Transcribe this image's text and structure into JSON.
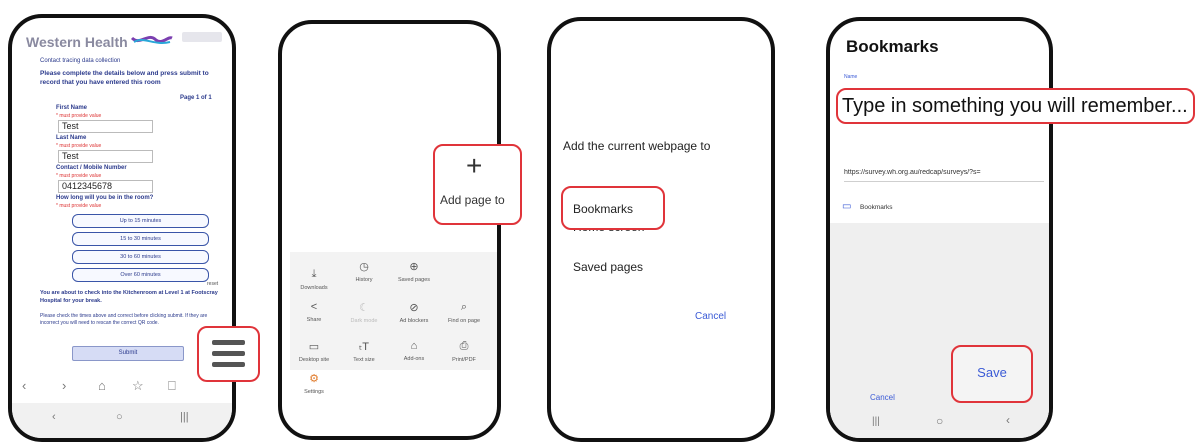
{
  "phone1": {
    "brand": "Western Health",
    "header_small": "Contact tracing data collection",
    "intro": "Please complete the details below and press submit to record that you have entered this room",
    "page_indicator": "Page 1 of 1",
    "first_name_label": "First Name",
    "first_name_value": "Test",
    "last_name_label": "Last Name",
    "last_name_value": "Test",
    "contact_label": "Contact / Mobile Number",
    "contact_value": "0412345678",
    "duration_question": "How long will you be in the room?",
    "required_note": "* must provide value",
    "duration_options": [
      "Up to 15 minutes",
      "15 to 30 minutes",
      "30 to 60 minutes",
      "Over 60 minutes"
    ],
    "reset_label": "reset",
    "checkout_text": "You are about to check into the Kitchenroom at Level 1 at Footscray Hospital for your break.",
    "footer_text": "Please check the times above and correct before clicking submit. If they are incorrect you will need to rescan the correct QR code.",
    "submit_label": "Submit",
    "nav_icons": [
      "‹",
      "›",
      "⌂",
      "☆",
      "⎕"
    ]
  },
  "phone2": {
    "menu_items": [
      {
        "icon": "⤓",
        "label": "Downloads"
      },
      {
        "icon": "◷",
        "label": "History"
      },
      {
        "icon": "⊕",
        "label": "Saved pages"
      },
      {
        "icon": "<",
        "label": "Share"
      },
      {
        "icon": "☾",
        "label": "Dark mode"
      },
      {
        "icon": "⊘",
        "label": "Ad blockers"
      },
      {
        "icon": "⌕",
        "label": "Find on page"
      },
      {
        "icon": "▭",
        "label": "Desktop site"
      },
      {
        "icon": "ₜT",
        "label": "Text size"
      },
      {
        "icon": "⌂",
        "label": "Add-ons"
      },
      {
        "icon": "⎙",
        "label": "Print/PDF"
      },
      {
        "icon": "⚙",
        "label": "Settings"
      }
    ],
    "add_page_label": "Add page to"
  },
  "phone3": {
    "title": "Add the current webpage to",
    "options": [
      "Bookmarks",
      "Home screen",
      "Saved pages"
    ],
    "cancel_label": "Cancel"
  },
  "phone4": {
    "title": "Bookmarks",
    "name_label": "Name",
    "name_value": "Type in something you will remember...",
    "url": "https://survey.wh.org.au/redcap/surveys/?s=",
    "folder_label": "Bookmarks",
    "cancel_label": "Cancel",
    "save_label": "Save"
  },
  "colors": {
    "highlight": "#e0343a",
    "link_blue": "#3b5bd6",
    "form_blue": "#2b3a8c"
  }
}
